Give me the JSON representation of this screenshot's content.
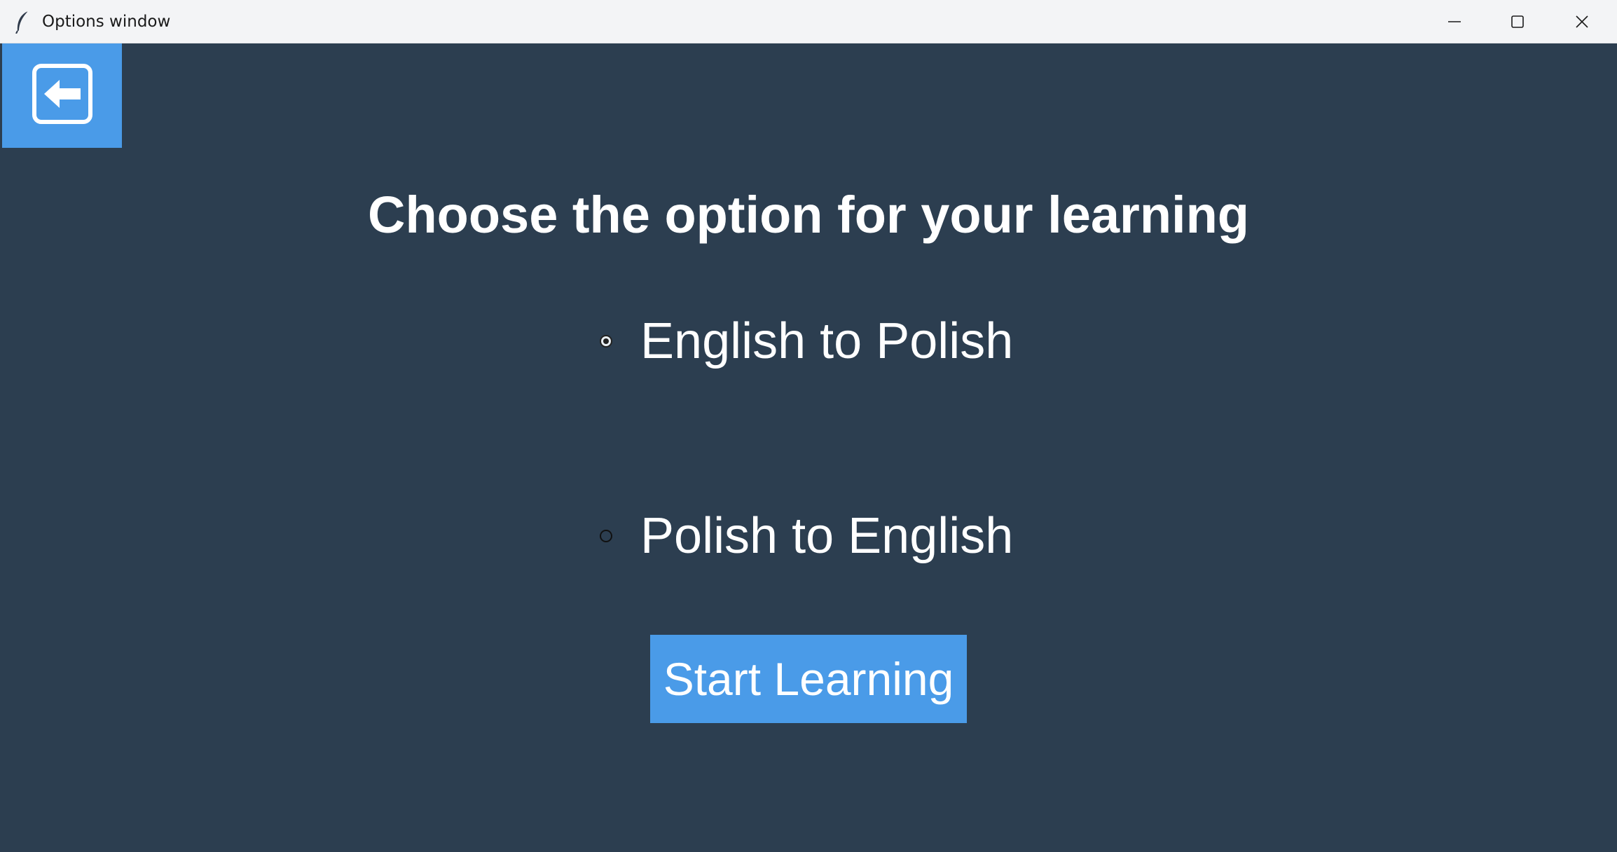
{
  "window": {
    "title": "Options window",
    "app_icon": "feather-icon",
    "controls": [
      "minimize-icon",
      "maximize-icon",
      "close-icon"
    ]
  },
  "toolbar": {
    "back_icon": "back-arrow-icon"
  },
  "main": {
    "heading": "Choose the option for your learning",
    "options": [
      {
        "label": "English to Polish",
        "selected": true
      },
      {
        "label": "Polish to English",
        "selected": false
      }
    ],
    "start_label": "Start Learning"
  },
  "colors": {
    "background": "#2c3e50",
    "accent": "#4a9be8",
    "text": "#ffffff",
    "titlebar": "#f3f4f6"
  }
}
